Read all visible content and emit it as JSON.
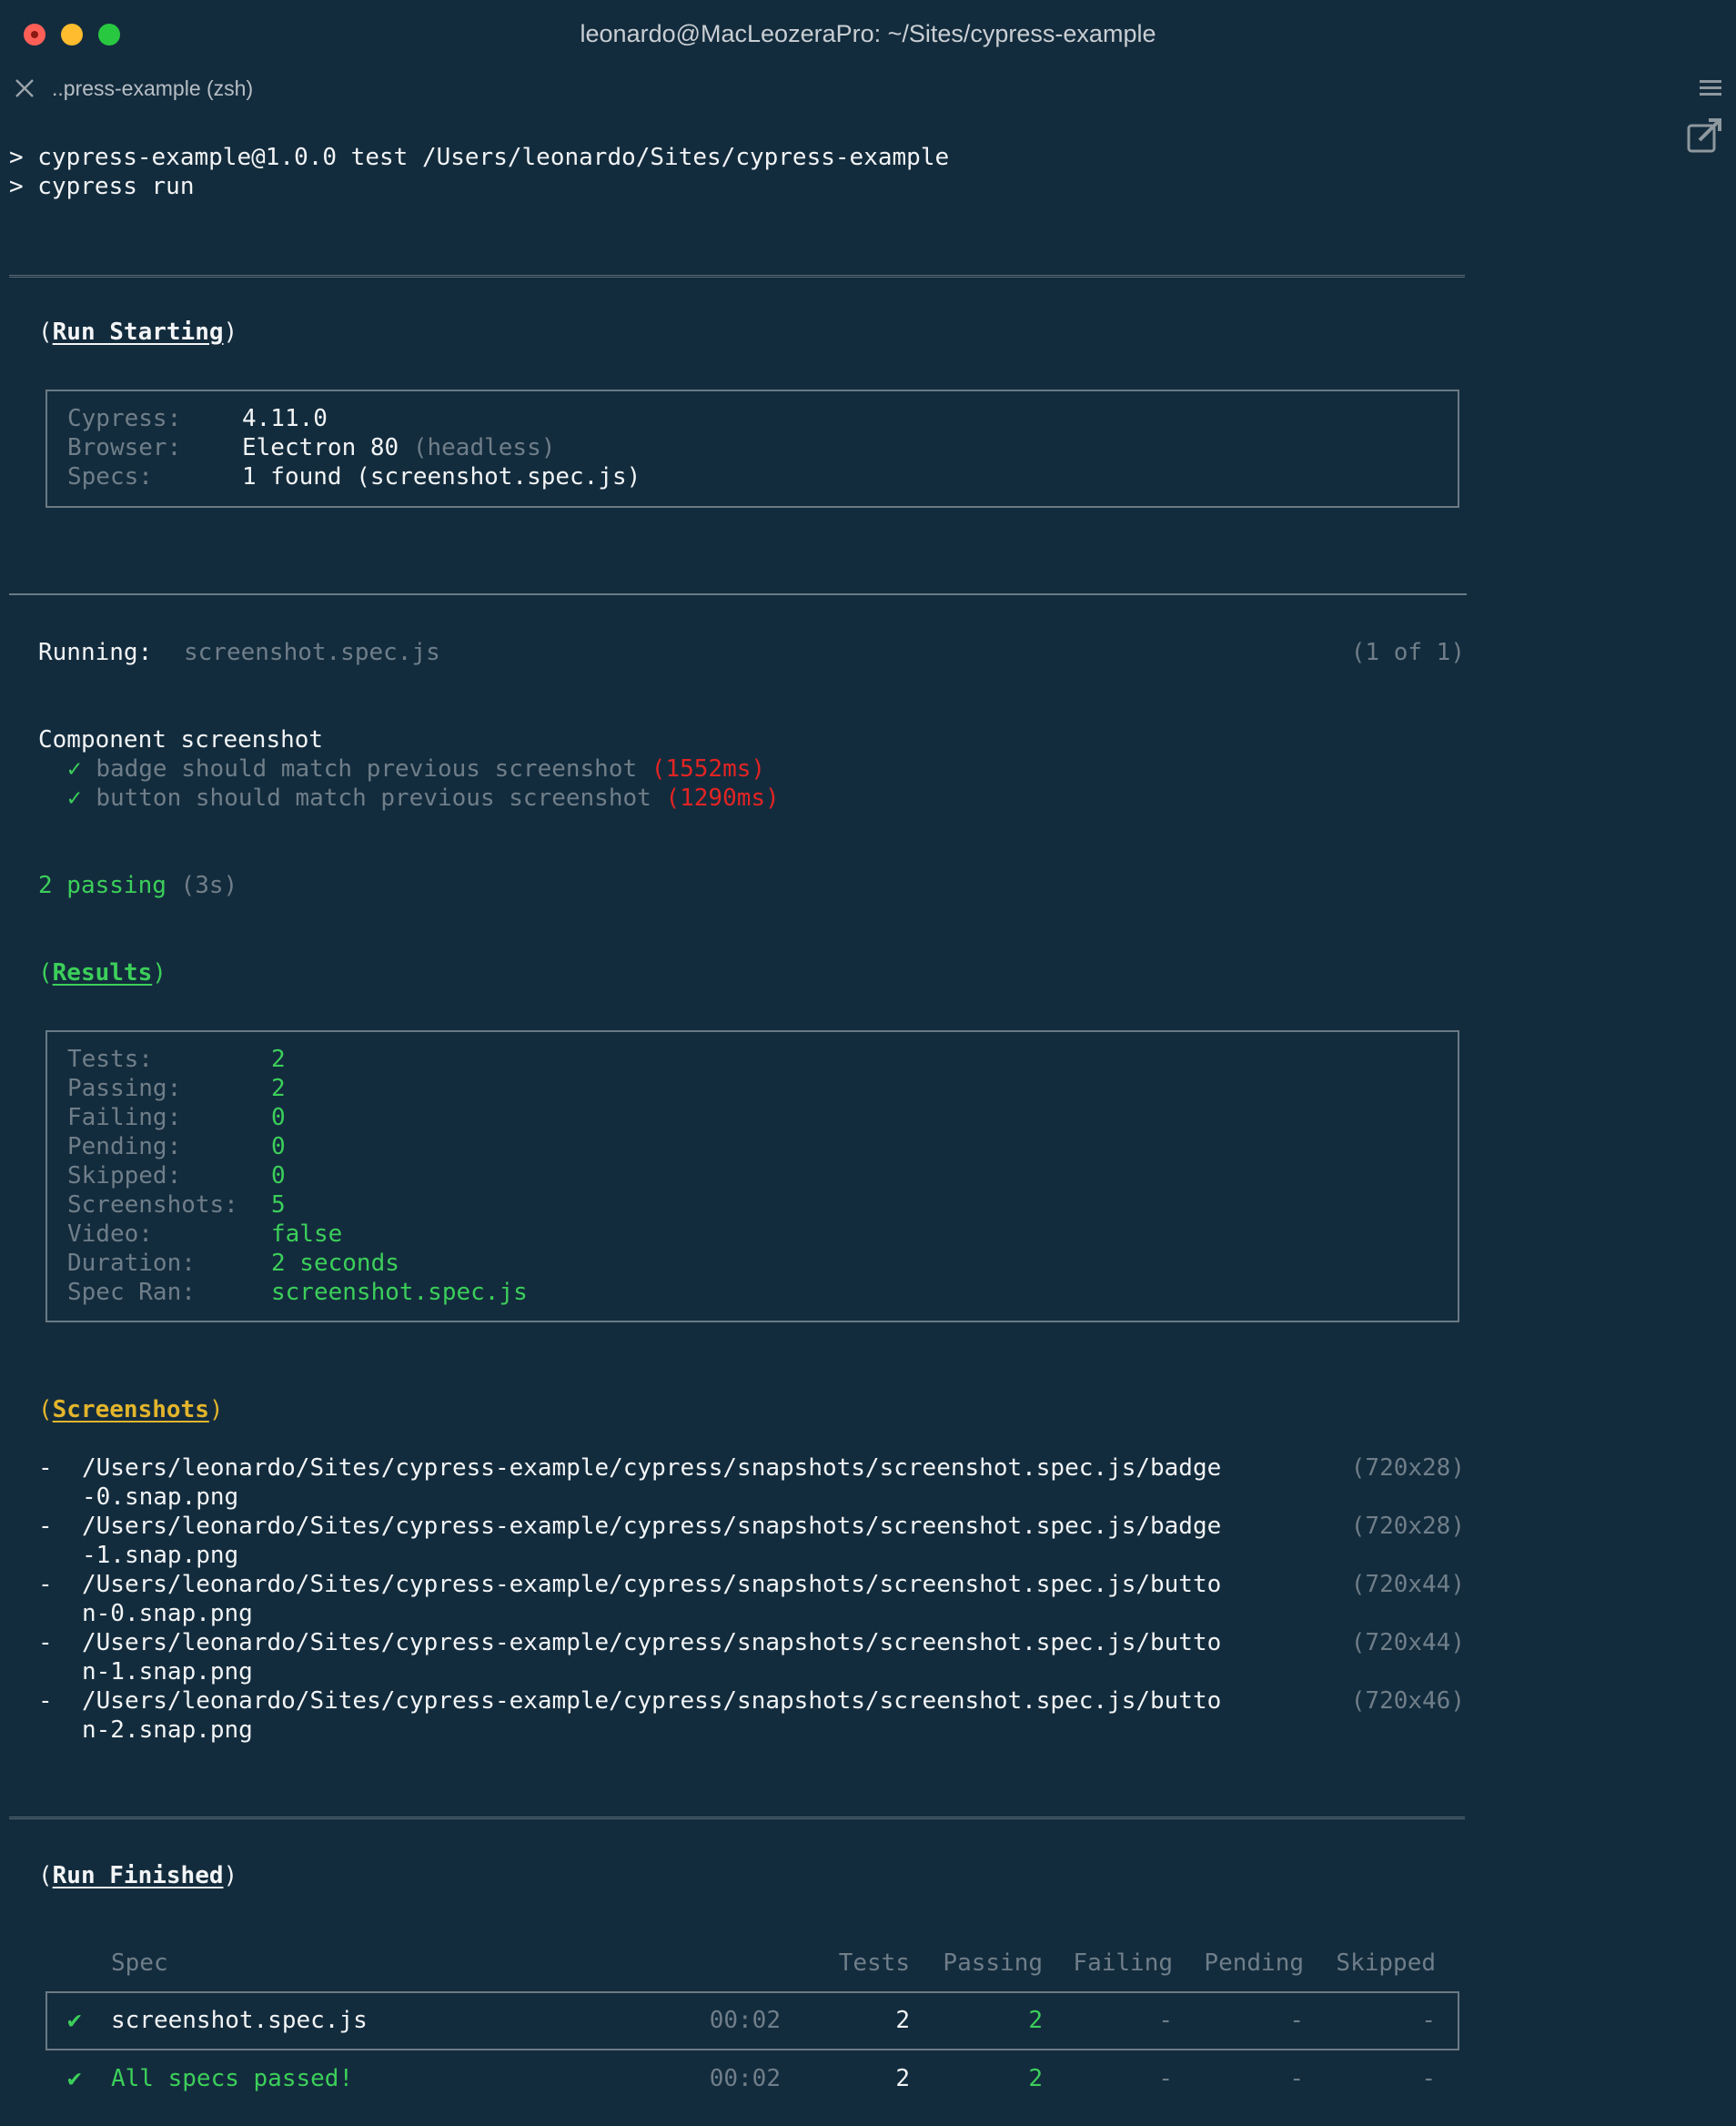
{
  "window": {
    "title": "leonardo@MacLeozeraPro: ~/Sites/cypress-example",
    "tab_label": "..press-example (zsh)"
  },
  "header_lines": [
    "> cypress-example@1.0.0 test /Users/leonardo/Sites/cypress-example",
    "> cypress run"
  ],
  "run_starting": {
    "title": "Run Starting",
    "rows": [
      {
        "label": "Cypress:",
        "value": "4.11.0",
        "extra": ""
      },
      {
        "label": "Browser:",
        "value": "Electron 80",
        "extra": "(headless)"
      },
      {
        "label": "Specs:",
        "value": "1 found (screenshot.spec.js)",
        "extra": ""
      }
    ]
  },
  "running": {
    "label": "Running:",
    "spec": "screenshot.spec.js",
    "count": "(1 of 1)"
  },
  "suite": {
    "name": "Component screenshot",
    "tests": [
      {
        "check": "✓",
        "name": "badge should match previous screenshot",
        "time": "(1552ms)"
      },
      {
        "check": "✓",
        "name": "button should match previous screenshot",
        "time": "(1290ms)"
      }
    ]
  },
  "passing": {
    "text": "2 passing",
    "time": "(3s)"
  },
  "results": {
    "title": "Results",
    "rows": [
      {
        "label": "Tests:",
        "value": "2"
      },
      {
        "label": "Passing:",
        "value": "2"
      },
      {
        "label": "Failing:",
        "value": "0"
      },
      {
        "label": "Pending:",
        "value": "0"
      },
      {
        "label": "Skipped:",
        "value": "0"
      },
      {
        "label": "Screenshots:",
        "value": "5"
      },
      {
        "label": "Video:",
        "value": "false"
      },
      {
        "label": "Duration:",
        "value": "2 seconds"
      },
      {
        "label": "Spec Ran:",
        "value": "screenshot.spec.js"
      }
    ]
  },
  "screenshots": {
    "title": "Screenshots",
    "items": [
      {
        "path1": "/Users/leonardo/Sites/cypress-example/cypress/snapshots/screenshot.spec.js/badge",
        "path2": "-0.snap.png",
        "size": "(720x28)"
      },
      {
        "path1": "/Users/leonardo/Sites/cypress-example/cypress/snapshots/screenshot.spec.js/badge",
        "path2": "-1.snap.png",
        "size": "(720x28)"
      },
      {
        "path1": "/Users/leonardo/Sites/cypress-example/cypress/snapshots/screenshot.spec.js/butto",
        "path2": "n-0.snap.png",
        "size": "(720x44)"
      },
      {
        "path1": "/Users/leonardo/Sites/cypress-example/cypress/snapshots/screenshot.spec.js/butto",
        "path2": "n-1.snap.png",
        "size": "(720x44)"
      },
      {
        "path1": "/Users/leonardo/Sites/cypress-example/cypress/snapshots/screenshot.spec.js/butto",
        "path2": "n-2.snap.png",
        "size": "(720x46)"
      }
    ]
  },
  "run_finished": {
    "title": "Run Finished",
    "headers": {
      "spec": "Spec",
      "tests": "Tests",
      "passing": "Passing",
      "failing": "Failing",
      "pending": "Pending",
      "skipped": "Skipped"
    },
    "row": {
      "check": "✔",
      "spec": "screenshot.spec.js",
      "time": "00:02",
      "tests": "2",
      "passing": "2",
      "failing": "-",
      "pending": "-",
      "skipped": "-"
    },
    "summary": {
      "check": "✔",
      "text": "All specs passed!",
      "time": "00:02",
      "tests": "2",
      "passing": "2",
      "failing": "-",
      "pending": "-",
      "skipped": "-"
    }
  },
  "colors": {
    "background": "#132c3d",
    "green": "#3ccf5a",
    "red": "#e32424",
    "yellow": "#e3b52b",
    "dim": "#6f7e89"
  }
}
